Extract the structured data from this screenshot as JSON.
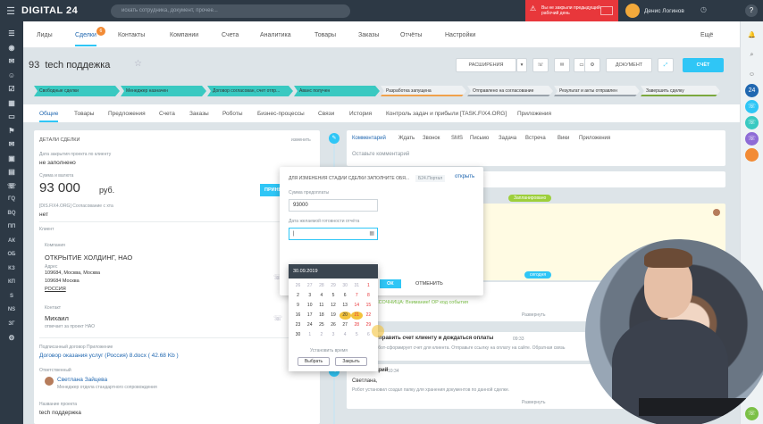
{
  "app": {
    "logo": "DIGITAL 24",
    "search_placeholder": "искать сотрудника, документ, прочее...",
    "alert_text": "Вы не закрыли предыдущий рабочий день",
    "user_name": "Денис Логинов",
    "help": "?"
  },
  "nav": [
    "Лиды",
    "Сделки",
    "Контакты",
    "Компании",
    "Счета",
    "Аналитика",
    "Товары",
    "Заказы",
    "Отчёты",
    "Настройки"
  ],
  "nav_badge": "6",
  "nav_more": "Ещё",
  "deal": {
    "number": "93",
    "title": "tech поддежка"
  },
  "toolbar": {
    "extensions": "РАСШИРЕНИЯ",
    "document": "ДОКУМЕНТ",
    "invoice": "СЧЁТ"
  },
  "stages": [
    {
      "label": "Свободные сделки",
      "state": "done"
    },
    {
      "label": "Менеджер назначен",
      "state": "done"
    },
    {
      "label": "Договор согласован, счет отпр...",
      "state": "done"
    },
    {
      "label": "Аванс получен",
      "state": "done"
    },
    {
      "label": "Разработка запущена",
      "state": "todo"
    },
    {
      "label": "Отправлено на согласование",
      "state": "todo2"
    },
    {
      "label": "Результат и акты отправлен",
      "state": "todo2"
    },
    {
      "label": "Завершить сделку",
      "state": "todo3"
    }
  ],
  "tabs": [
    "Общие",
    "Товары",
    "Предложения",
    "Счета",
    "Заказы",
    "Роботы",
    "Бизнес-процессы",
    "Связи",
    "История",
    "Контроль задач и прибыли [TASK.FIX4.ORG]",
    "Приложения"
  ],
  "card": {
    "header": "ДЕТАЛИ СДЕЛКИ",
    "change": "изменить",
    "date_label": "Дата закрытия проекта по клиенту",
    "date_value": "не заполнено",
    "sum_label": "Сумма и валюта",
    "sum_value": "93 000",
    "currency": "руб.",
    "accept": "ПРИНЯТЬ",
    "task_label": "[DIS.FIX4.ORG] Согласование с хта",
    "task_value": "нет",
    "client_label": "Клиент",
    "company_label": "Компания",
    "company_name": "ОТКРЫТИЕ ХОЛДИНГ, НАО",
    "address_label": "Адрес",
    "address_lines": [
      "109684, Москва, Москва",
      "109684 Москва",
      "РОССИЯ"
    ],
    "contact_label": "Контакт",
    "contact_name": "Михаил",
    "contact_role": "отвечает за проект НАО",
    "contract_label": "Подписанный договор Приложение",
    "contract_link": "Договор оказания услуг (Россия) 8.docx ( 42.68 Kb )",
    "responsible_label": "Ответственный",
    "responsible_name": "Светлана Зайцева",
    "responsible_role": "Менеджер отдела стандартного сопровождения",
    "project_label": "Название проекта",
    "project_value": "tech поддержка"
  },
  "comment_tabs": [
    "Комментарий",
    "Ждать",
    "Звонок",
    "SMS",
    "Письмо",
    "Задача",
    "Встреча",
    "Вики",
    "Приложения"
  ],
  "comment_placeholder": "Оставьте комментарий",
  "popup": {
    "header": "ДЛЯ ИЗМЕНЕНИЯ СТАДИИ СДЕЛКИ ЗАПОЛНИТЕ ОБЯ...",
    "b24": "Б24.Портал",
    "open": "открыть",
    "sum_label": "Сумма предоплаты",
    "sum_value": "93000",
    "date_label": "Дата желаемой готовности отчёта",
    "date_value": "|",
    "save": "ОК",
    "cancel": "ОТМЕНИТЬ"
  },
  "calendar": {
    "header": "30.09.2019",
    "days": [
      "26",
      "27",
      "28",
      "29",
      "30",
      "31",
      "1",
      "2",
      "3",
      "4",
      "5",
      "6",
      "7",
      "8",
      "9",
      "10",
      "11",
      "12",
      "13",
      "14",
      "15",
      "16",
      "17",
      "18",
      "19",
      "20",
      "21",
      "22",
      "23",
      "24",
      "25",
      "26",
      "27",
      "28",
      "29",
      "30",
      "1",
      "2",
      "3",
      "4",
      "5",
      "6"
    ],
    "set_time": "Установить время",
    "choose": "Выбрать",
    "close": "Закрыть"
  },
  "timeline": {
    "badge_planned": "Запланировано",
    "badge_today": "сегодня",
    "warning": "ПЕСОЧНИЦА: Внимание! ОР код события",
    "expand": "Развернуть",
    "task_title": "Задача: Отправить счет клиенту и дождаться оплаты",
    "task_time": "09:33",
    "task_desc": "Отправьте робот-сформирует счет для клиента. Отправьте ссылку на оплату на сайте. Обратная связь",
    "comment_title": "Комментарий",
    "comment_time": "10:34",
    "comment_greet": "Светлана,",
    "comment_text": "Робот установил создал папку для хранения документов по данной сделке.",
    "expand2": "Развернуть"
  }
}
